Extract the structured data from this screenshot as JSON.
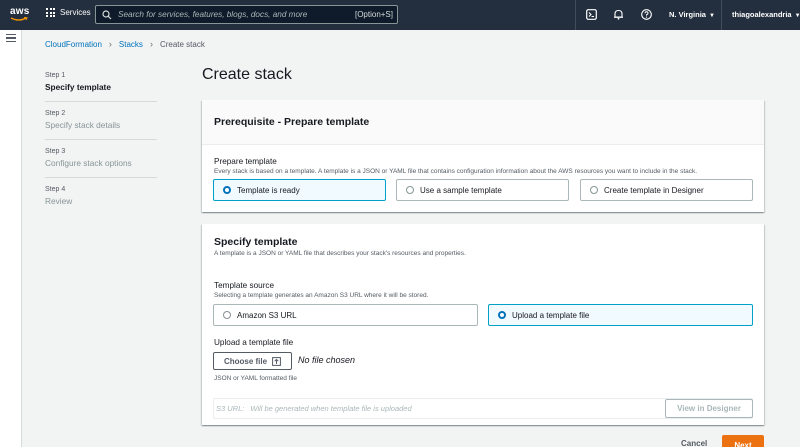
{
  "nav": {
    "logo_text": "aws",
    "services_label": "Services",
    "search_placeholder": "Search for services, features, blogs, docs, and more",
    "search_shortcut": "[Option+S]",
    "region": "N. Virginia",
    "user": "thiagoalexandria",
    "caret": "▼"
  },
  "breadcrumb": {
    "items": [
      "CloudFormation",
      "Stacks"
    ],
    "current": "Create stack",
    "separator": "›"
  },
  "steps": [
    {
      "number": "Step 1",
      "label": "Specify template"
    },
    {
      "number": "Step 2",
      "label": "Specify stack details"
    },
    {
      "number": "Step 3",
      "label": "Configure stack options"
    },
    {
      "number": "Step 4",
      "label": "Review"
    }
  ],
  "page_title": "Create stack",
  "prerequisite": {
    "heading": "Prerequisite - Prepare template",
    "field_label": "Prepare template",
    "field_desc": "Every stack is based on a template. A template is a JSON or YAML file that contains configuration information about the AWS resources you want to include in the stack.",
    "options": [
      "Template is ready",
      "Use a sample template",
      "Create template in Designer"
    ],
    "selected_index": 0
  },
  "specify": {
    "heading": "Specify template",
    "desc": "A template is a JSON or YAML file that describes your stack's resources and properties.",
    "source_label": "Template source",
    "source_desc": "Selecting a template generates an Amazon S3 URL where it will be stored.",
    "source_options": [
      "Amazon S3 URL",
      "Upload a template file"
    ],
    "source_selected_index": 1,
    "upload_label": "Upload a template file",
    "choose_file": "Choose file",
    "no_file": "No file chosen",
    "upload_hint": "JSON or YAML formatted file",
    "s3_label": "S3 URL:",
    "s3_value": "Will be generated when template file is uploaded",
    "view_designer": "View in Designer"
  },
  "footer": {
    "cancel": "Cancel",
    "next": "Next"
  },
  "colors": {
    "nav_bg": "#232f3e",
    "link": "#0073bb",
    "primary": "#ec7211",
    "selected_border": "#00a1c9"
  }
}
